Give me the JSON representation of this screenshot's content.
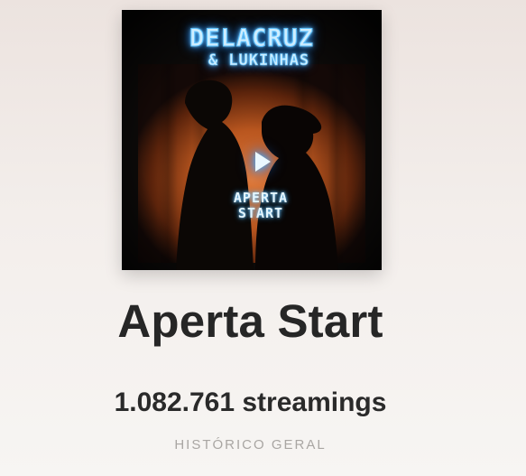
{
  "album": {
    "cover": {
      "artist_text": "DELACRUZ",
      "feature_text": "& LUKINHAS",
      "title_line1": "APERTA",
      "title_line2": "START",
      "icon": "play-icon",
      "neon_color": "#33a8ff",
      "curtain_color": "#c4622a"
    },
    "title": "Aperta Start",
    "streams": "1.082.761 streamings",
    "caption": "HISTÓRICO GERAL"
  }
}
